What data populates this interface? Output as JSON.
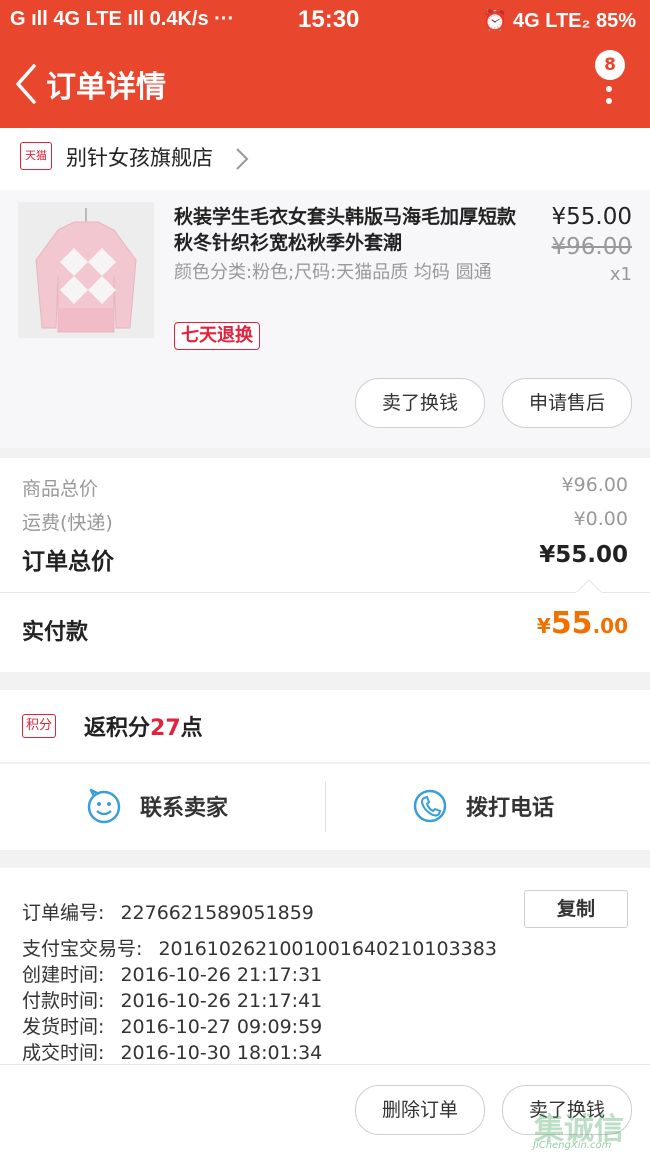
{
  "status_bar": {
    "left": "G ıll 4G LTE ıll 0.4K/s ···",
    "time": "15:30",
    "right": "⏰ 4G LTE₂ 85%"
  },
  "nav": {
    "title": "订单详情",
    "badge_count": "8",
    "back_icon": "chevron-left-icon",
    "more_icon": "more-vertical-icon"
  },
  "shop": {
    "logo_text": "天猫",
    "name": "别针女孩旗舰店"
  },
  "product": {
    "title": "秋装学生毛衣女套头韩版马海毛加厚短款秋冬针织衫宽松秋季外套潮",
    "attributes": "颜色分类:粉色;尺码:天猫品质 均码 圆通",
    "return_tag": "七天退换",
    "price": "¥55.00",
    "original_price": "¥96.00",
    "quantity": "x1",
    "buttons": [
      "卖了换钱",
      "申请售后"
    ]
  },
  "summary": {
    "goods_total_label": "商品总价",
    "goods_total_value": "¥96.00",
    "shipping_label": "运费(快递)",
    "shipping_value": "¥0.00",
    "order_total_label": "订单总价",
    "order_total_value": "¥55.00",
    "paid_label": "实付款",
    "paid_currency": "¥",
    "paid_integer": "55",
    "paid_decimal": ".00"
  },
  "points": {
    "tag": "积分",
    "prefix": "返积分",
    "count": "27",
    "suffix": "点"
  },
  "contact": {
    "seller_label": "联系卖家",
    "phone_label": "拨打电话"
  },
  "order_info": {
    "order_no_label": "订单编号:",
    "order_no": "2276621589051859",
    "copy_label": "复制",
    "alipay_label": "支付宝交易号:",
    "alipay_no": "2016102621001001640210103383",
    "created_label": "创建时间:",
    "created": "2016-10-26 21:17:31",
    "paid_label": "付款时间:",
    "paid": "2016-10-26 21:17:41",
    "shipped_label": "发货时间:",
    "shipped": "2016-10-27 09:09:59",
    "completed_label": "成交时间:",
    "completed": "2016-10-30 18:01:34"
  },
  "footer": {
    "buttons": [
      "删除订单",
      "卖了换钱"
    ]
  },
  "watermark": {
    "text": "集诚信",
    "url": "JiChengXin.com"
  },
  "colors": {
    "brand_red": "#e8462d",
    "tmall_red": "#e3223b",
    "price_orange": "#f07000",
    "icon_blue": "#3a9fd8"
  }
}
